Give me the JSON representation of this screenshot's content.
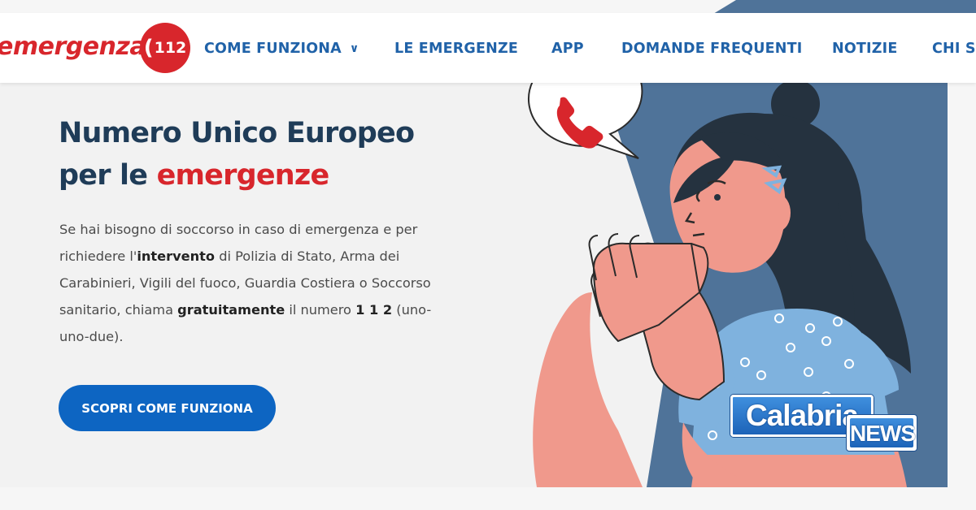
{
  "brand": {
    "name": "emergenza",
    "badge_number": "112"
  },
  "nav": {
    "items": [
      {
        "label": "COME FUNZIONA"
      },
      {
        "label": "LE EMERGENZE"
      },
      {
        "label": "APP"
      },
      {
        "label": "DOMANDE FREQUENTI"
      },
      {
        "label": "NOTIZIE"
      },
      {
        "label": "CHI SI"
      }
    ]
  },
  "hero": {
    "title_line1": "Numero Unico Europeo",
    "title_line2_prefix": "per le ",
    "title_line2_accent": "emergenze",
    "desc_1": "Se hai bisogno di soccorso in caso di emergenza e per",
    "desc_2a": "richiedere l'",
    "desc_2b": "intervento",
    "desc_2c": " di Polizia di Stato, Arma dei",
    "desc_3": "Carabinieri, Vigili del fuoco, Guardia Costiera o Soccorso",
    "desc_4a": "sanitario, chiama ",
    "desc_4b": "gratuitamente",
    "desc_4c": " il numero ",
    "desc_4d": "1 1 2",
    "desc_4e": " (uno-",
    "desc_5": "uno-due).",
    "cta_label": "SCOPRI COME FUNZIONA"
  },
  "watermark": {
    "line1": "Calabria",
    "line2": "NEWS"
  },
  "icons": {
    "speech_bubble": "phone-icon",
    "nav_dropdown": "chevron-down-icon"
  },
  "colors": {
    "brand_red": "#d8262c",
    "nav_blue": "#2062a8",
    "cta_blue": "#0d65c2",
    "title_navy": "#1f3c58",
    "panel_blue": "#4f7399"
  }
}
